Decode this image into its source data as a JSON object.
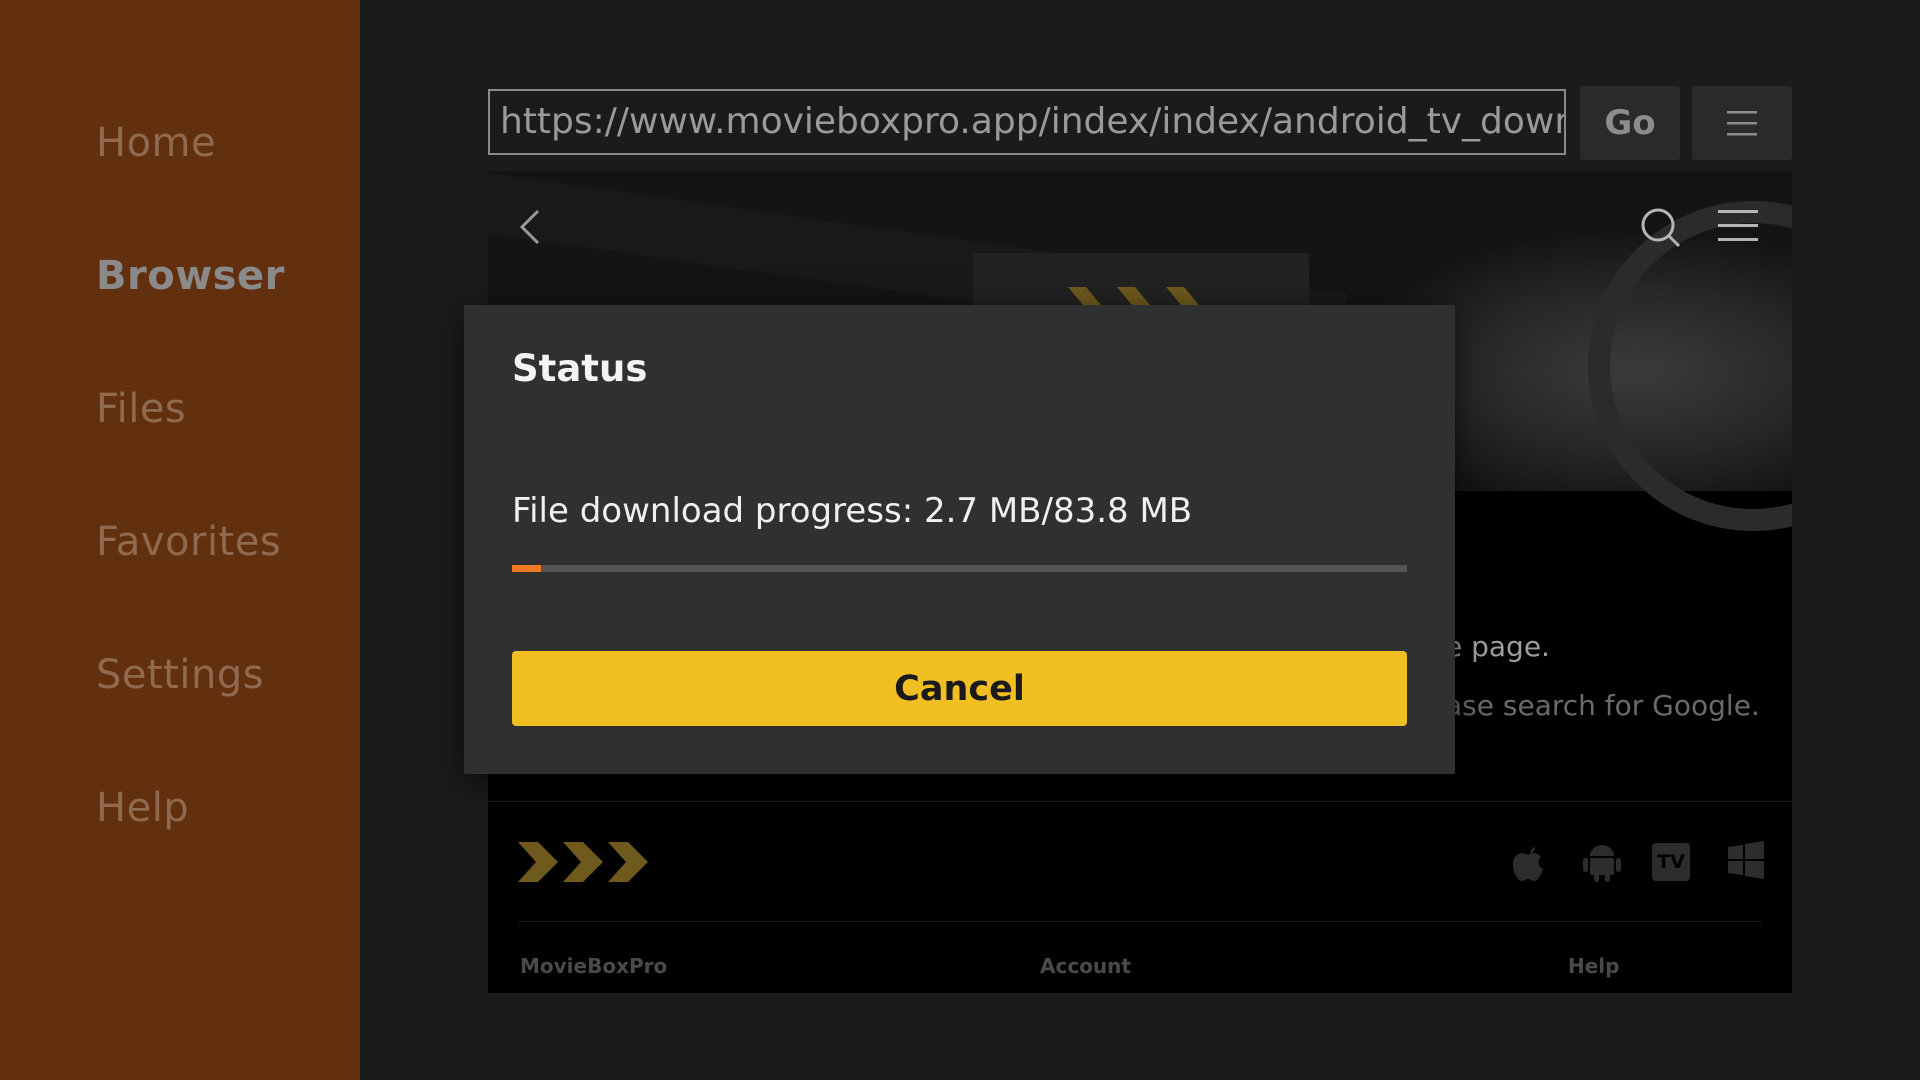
{
  "sidebar": {
    "items": [
      {
        "label": "Home",
        "active": false
      },
      {
        "label": "Browser",
        "active": true
      },
      {
        "label": "Files",
        "active": false
      },
      {
        "label": "Favorites",
        "active": false
      },
      {
        "label": "Settings",
        "active": false
      },
      {
        "label": "Help",
        "active": false
      }
    ]
  },
  "toolbar": {
    "url": "https://www.movieboxpro.app/index/index/android_tv_download",
    "go_label": "Go",
    "menu_icon": "hamburger-icon"
  },
  "webpage": {
    "nav_icons": [
      "back-icon",
      "search-icon",
      "hamburger-icon"
    ],
    "partial_text_1": "e page.",
    "partial_text_2": "ase search for Google.",
    "platform_icons": [
      "apple-icon",
      "android-icon",
      "tv-icon",
      "windows-icon"
    ],
    "tv_badge": "TV",
    "footer_links": [
      "MovieBoxPro",
      "Account",
      "Help"
    ]
  },
  "dialog": {
    "title": "Status",
    "message": "File download progress: 2.7 MB/83.8 MB",
    "progress_fraction": 0.032,
    "cancel_label": "Cancel"
  },
  "colors": {
    "sidebar_bg": "#622f0f",
    "accent_progress": "#f07a22",
    "cancel_button": "#f2bf23",
    "logo_chevrons": "#6e5a1c"
  }
}
